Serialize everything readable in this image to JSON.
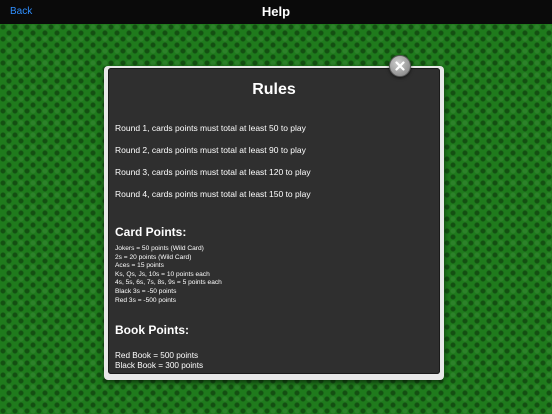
{
  "navbar": {
    "back_label": "Back",
    "title": "Help"
  },
  "rules": {
    "title": "Rules",
    "rounds": [
      "Round 1, cards points must total at least 50 to play",
      "Round 2, cards points must total at least 90 to play",
      "Round 3, cards points must total at least 120 to play",
      "Round 4, cards points must total at least 150 to play"
    ],
    "card_points_heading": "Card Points:",
    "card_points": [
      "Jokers = 50 points (Wild Card)",
      "2s = 20 points (Wild Card)",
      "Aces = 15 points",
      "Ks, Qs, Js, 10s = 10 points each",
      "4s, 5s, 6s, 7s, 8s, 9s = 5 points each",
      "Black 3s = -50 points",
      "Red 3s = -500 points"
    ],
    "book_points_heading": "Book Points:",
    "book_points": [
      "Red Book = 500 points",
      "Black Book = 300 points"
    ]
  },
  "icons": {
    "close": "close-icon"
  }
}
